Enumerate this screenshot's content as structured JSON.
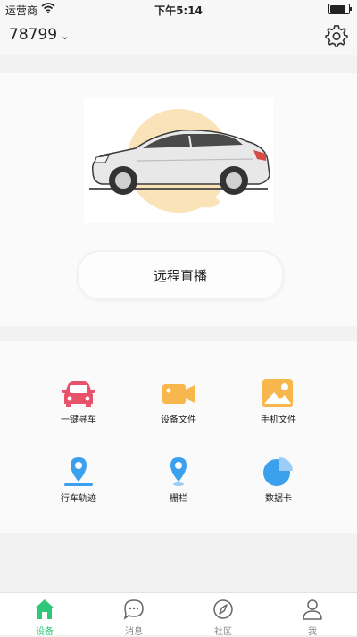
{
  "status_bar": {
    "carrier": "运营商",
    "time": "下午5:14",
    "battery_level": 0.9
  },
  "header": {
    "device_id": "78799",
    "settings_icon": "gear-icon"
  },
  "live": {
    "button_label": "远程直播"
  },
  "features": [
    {
      "label": "一键寻车",
      "icon": "car-icon",
      "color": "#e8536b"
    },
    {
      "label": "设备文件",
      "icon": "video-camera-icon",
      "color": "#f8b74d"
    },
    {
      "label": "手机文件",
      "icon": "image-icon",
      "color": "#f8b74d"
    },
    {
      "label": "行车轨迹",
      "icon": "route-pin-icon",
      "color": "#3ba0ee"
    },
    {
      "label": "栅栏",
      "icon": "location-pin-icon",
      "color": "#3ba0ee"
    },
    {
      "label": "数据卡",
      "icon": "pie-chart-icon",
      "color": "#3ba0ee"
    }
  ],
  "tabs": [
    {
      "label": "设备",
      "icon": "home-icon",
      "active": true
    },
    {
      "label": "消息",
      "icon": "message-icon",
      "active": false
    },
    {
      "label": "社区",
      "icon": "compass-icon",
      "active": false
    },
    {
      "label": "我",
      "icon": "user-icon",
      "active": false
    }
  ],
  "colors": {
    "accent": "#2ec77a",
    "car_bg": "#fbe3b9"
  }
}
